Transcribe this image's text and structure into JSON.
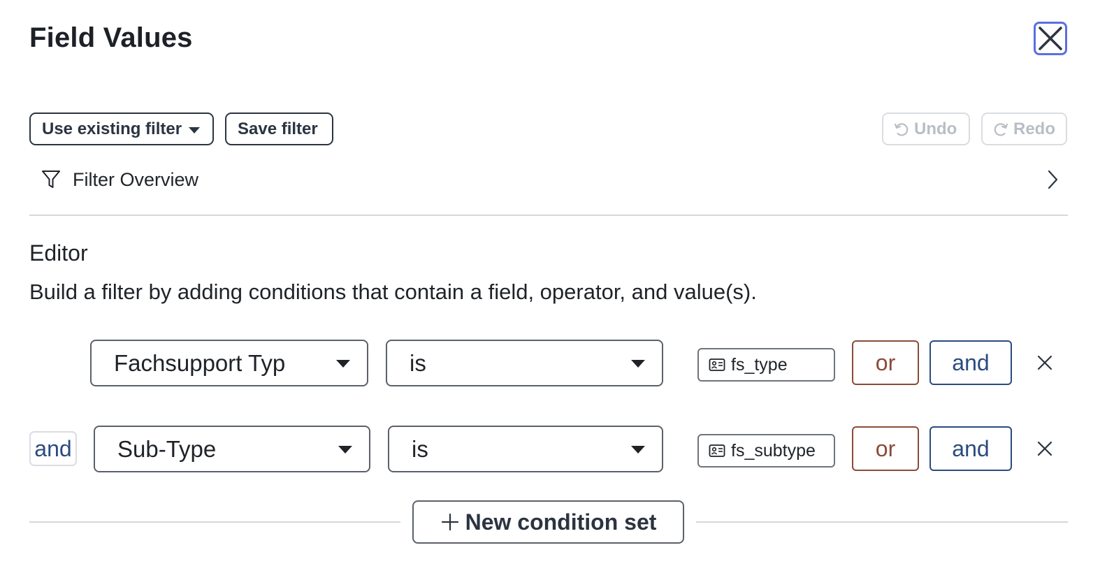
{
  "dialog": {
    "title": "Field Values"
  },
  "toolbar": {
    "use_existing_filter": "Use existing filter",
    "save_filter": "Save filter",
    "undo": "Undo",
    "redo": "Redo"
  },
  "overview": {
    "label": "Filter Overview"
  },
  "editor": {
    "title": "Editor",
    "description": "Build a filter by adding conditions that contain a field, operator, and value(s)."
  },
  "conditions": [
    {
      "field": "Fachsupport Typ",
      "operator": "is",
      "value": "fs_type",
      "or_label": "or",
      "and_label": "and"
    },
    {
      "connector": "and",
      "field": "Sub-Type",
      "operator": "is",
      "value": "fs_subtype",
      "or_label": "or",
      "and_label": "and"
    }
  ],
  "new_condition_set": "New condition set",
  "colors": {
    "focus_ring": "#5a6fe0",
    "or": "#8a4b38",
    "and": "#2b4b7e",
    "disabled": "#b9bec5"
  }
}
